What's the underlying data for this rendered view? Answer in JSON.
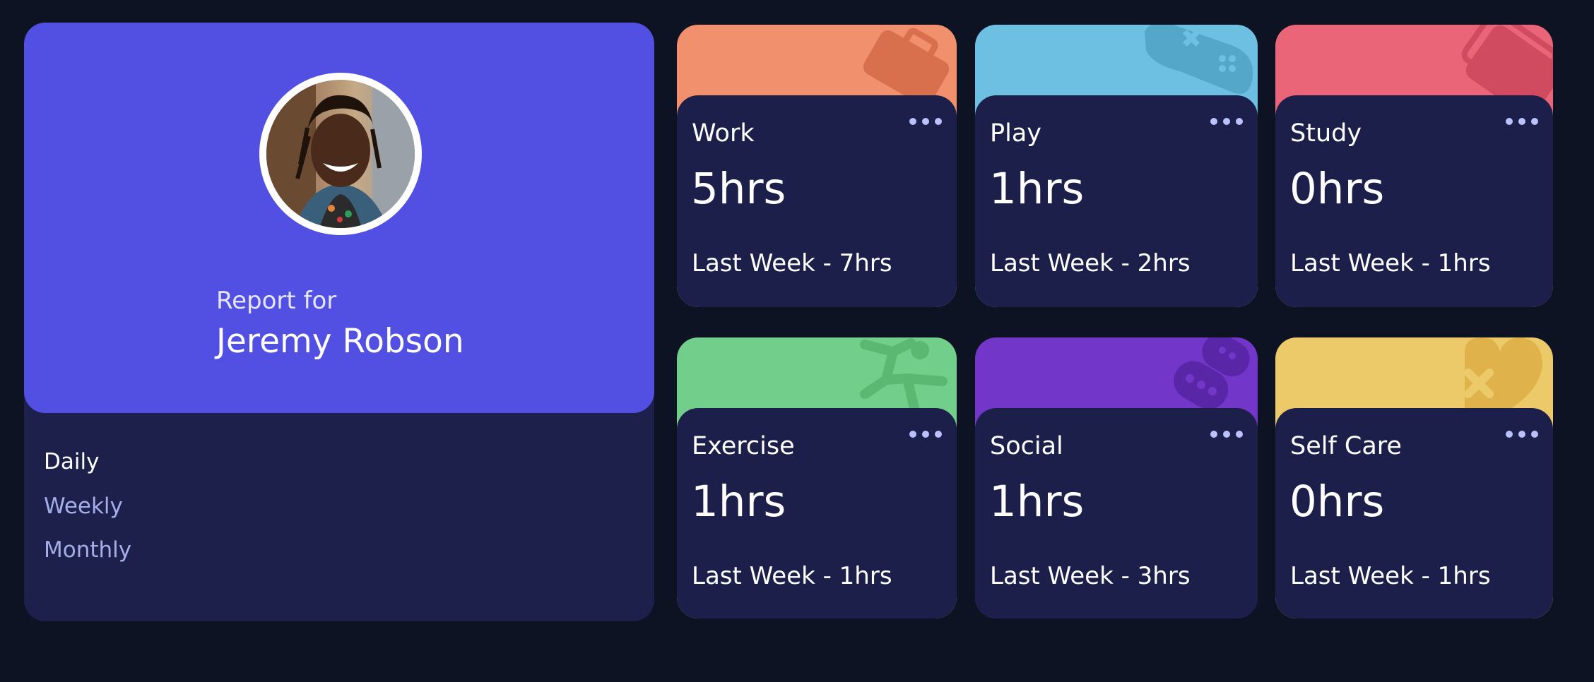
{
  "profile": {
    "report_label": "Report for",
    "name": "Jeremy Robson",
    "periods": [
      "Daily",
      "Weekly",
      "Monthly"
    ],
    "active_period": "Daily"
  },
  "activities": [
    {
      "title": "Work",
      "current": "5hrs",
      "previous": "Last Week - 7hrs",
      "color": "#f0906c",
      "icon": "briefcase-icon"
    },
    {
      "title": "Play",
      "current": "1hrs",
      "previous": "Last Week - 2hrs",
      "color": "#6ec0e2",
      "icon": "gamepad-icon"
    },
    {
      "title": "Study",
      "current": "0hrs",
      "previous": "Last Week - 1hrs",
      "color": "#eb6579",
      "icon": "books-icon"
    },
    {
      "title": "Exercise",
      "current": "1hrs",
      "previous": "Last Week - 1hrs",
      "color": "#72cf8b",
      "icon": "running-figure-icon"
    },
    {
      "title": "Social",
      "current": "1hrs",
      "previous": "Last Week - 3hrs",
      "color": "#7237c9",
      "icon": "chat-bubbles-icon"
    },
    {
      "title": "Self Care",
      "current": "0hrs",
      "previous": "Last Week - 1hrs",
      "color": "#ecca6a",
      "icon": "heart-icon"
    }
  ],
  "colors": {
    "page_background": "#0e1323",
    "card_background": "#1c1f4a",
    "profile_accent": "#5150e2",
    "muted_text": "#a5aee9",
    "dots": "#bbc0ff"
  }
}
